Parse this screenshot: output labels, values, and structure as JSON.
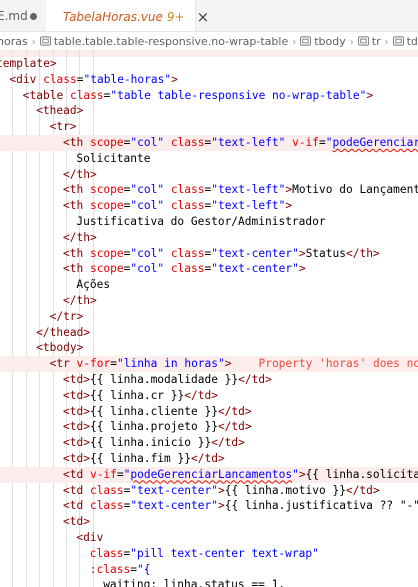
{
  "tabs": [
    {
      "label": "E.md",
      "modified": true
    },
    {
      "label": "TabelaHoras.vue",
      "badge": "9+",
      "close": "×",
      "active": true
    }
  ],
  "breadcrumb": [
    "horas",
    "table.table.table-responsive.no-wrap-table",
    "tbody",
    "tr",
    "td",
    "d"
  ],
  "code": {
    "lines": [
      {
        "indent": 0,
        "segs": [
          [
            "tag",
            "template>"
          ]
        ]
      },
      {
        "indent": 1,
        "segs": [
          [
            "tag",
            "<div "
          ],
          [
            "attr",
            "class"
          ],
          [
            "text",
            "="
          ],
          [
            "str",
            "\"table-horas\""
          ],
          [
            "tag",
            ">"
          ]
        ]
      },
      {
        "indent": 2,
        "segs": [
          [
            "tag",
            "<table "
          ],
          [
            "attr",
            "class"
          ],
          [
            "text",
            "="
          ],
          [
            "str",
            "\"table table-responsive no-wrap-table\""
          ],
          [
            "tag",
            ">"
          ]
        ]
      },
      {
        "indent": 3,
        "segs": [
          [
            "tag",
            "<thead>"
          ]
        ]
      },
      {
        "indent": 4,
        "segs": [
          [
            "tag",
            "<tr>"
          ]
        ]
      },
      {
        "indent": 5,
        "hl": true,
        "segs": [
          [
            "tag",
            "<th "
          ],
          [
            "attr",
            "scope"
          ],
          [
            "text",
            "="
          ],
          [
            "str",
            "\"col\" "
          ],
          [
            "attr",
            "class"
          ],
          [
            "text",
            "="
          ],
          [
            "str",
            "\"text-left\" "
          ],
          [
            "attr",
            "v-if"
          ],
          [
            "text",
            "="
          ],
          [
            "str",
            "\""
          ],
          [
            "sq",
            "podeGerenciarLanc"
          ]
        ]
      },
      {
        "indent": 6,
        "segs": [
          [
            "text",
            "Solicitante"
          ]
        ]
      },
      {
        "indent": 5,
        "segs": [
          [
            "tag",
            "</th>"
          ]
        ]
      },
      {
        "indent": 5,
        "segs": [
          [
            "tag",
            "<th "
          ],
          [
            "attr",
            "scope"
          ],
          [
            "text",
            "="
          ],
          [
            "str",
            "\"col\" "
          ],
          [
            "attr",
            "class"
          ],
          [
            "text",
            "="
          ],
          [
            "str",
            "\"text-left\""
          ],
          [
            "tag",
            ">"
          ],
          [
            "text",
            "Motivo do Lançamento"
          ],
          [
            "tag",
            "</t"
          ]
        ]
      },
      {
        "indent": 5,
        "segs": [
          [
            "tag",
            "<th "
          ],
          [
            "attr",
            "scope"
          ],
          [
            "text",
            "="
          ],
          [
            "str",
            "\"col\" "
          ],
          [
            "attr",
            "class"
          ],
          [
            "text",
            "="
          ],
          [
            "str",
            "\"text-left\""
          ],
          [
            "tag",
            ">"
          ]
        ]
      },
      {
        "indent": 6,
        "segs": [
          [
            "text",
            "Justificativa do Gestor/Administrador"
          ]
        ]
      },
      {
        "indent": 5,
        "segs": [
          [
            "tag",
            "</th>"
          ]
        ]
      },
      {
        "indent": 5,
        "segs": [
          [
            "tag",
            "<th "
          ],
          [
            "attr",
            "scope"
          ],
          [
            "text",
            "="
          ],
          [
            "str",
            "\"col\" "
          ],
          [
            "attr",
            "class"
          ],
          [
            "text",
            "="
          ],
          [
            "str",
            "\"text-center\""
          ],
          [
            "tag",
            ">"
          ],
          [
            "text",
            "Status"
          ],
          [
            "tag",
            "</th>"
          ]
        ]
      },
      {
        "indent": 5,
        "segs": [
          [
            "tag",
            "<th "
          ],
          [
            "attr",
            "scope"
          ],
          [
            "text",
            "="
          ],
          [
            "str",
            "\"col\" "
          ],
          [
            "attr",
            "class"
          ],
          [
            "text",
            "="
          ],
          [
            "str",
            "\"text-center\""
          ],
          [
            "tag",
            ">"
          ]
        ]
      },
      {
        "indent": 6,
        "segs": [
          [
            "text",
            "Ações"
          ]
        ]
      },
      {
        "indent": 5,
        "segs": [
          [
            "tag",
            "</th>"
          ]
        ]
      },
      {
        "indent": 4,
        "segs": [
          [
            "tag",
            "</tr>"
          ]
        ]
      },
      {
        "indent": 3,
        "segs": [
          [
            "tag",
            "</thead>"
          ]
        ]
      },
      {
        "indent": 3,
        "segs": [
          [
            "tag",
            "<tbody>"
          ]
        ]
      },
      {
        "indent": 4,
        "hl": true,
        "segs": [
          [
            "tag",
            "<tr "
          ],
          [
            "attr",
            "v-for"
          ],
          [
            "text",
            "="
          ],
          [
            "str",
            "\"linha in horas\""
          ],
          [
            "tag",
            ">"
          ],
          [
            "text",
            "    "
          ],
          [
            "ghost",
            "Property 'horas' does not ex"
          ]
        ]
      },
      {
        "indent": 5,
        "segs": [
          [
            "tag",
            "<td>"
          ],
          [
            "must",
            "{{ linha.modalidade }}"
          ],
          [
            "tag",
            "</td>"
          ]
        ]
      },
      {
        "indent": 5,
        "segs": [
          [
            "tag",
            "<td>"
          ],
          [
            "must",
            "{{ linha.cr }}"
          ],
          [
            "tag",
            "</td>"
          ]
        ]
      },
      {
        "indent": 5,
        "segs": [
          [
            "tag",
            "<td>"
          ],
          [
            "must",
            "{{ linha.cliente }}"
          ],
          [
            "tag",
            "</td>"
          ]
        ]
      },
      {
        "indent": 5,
        "segs": [
          [
            "tag",
            "<td>"
          ],
          [
            "must",
            "{{ linha.projeto }}"
          ],
          [
            "tag",
            "</td>"
          ]
        ]
      },
      {
        "indent": 5,
        "segs": [
          [
            "tag",
            "<td>"
          ],
          [
            "must",
            "{{ linha.inicio }}"
          ],
          [
            "tag",
            "</td>"
          ]
        ]
      },
      {
        "indent": 5,
        "segs": [
          [
            "tag",
            "<td>"
          ],
          [
            "must",
            "{{ linha.fim }}"
          ],
          [
            "tag",
            "</td>"
          ]
        ]
      },
      {
        "indent": 5,
        "hl": true,
        "segs": [
          [
            "tag",
            "<td "
          ],
          [
            "attr",
            "v-if"
          ],
          [
            "text",
            "="
          ],
          [
            "str",
            "\""
          ],
          [
            "sq",
            "podeGerenciarLancamentos"
          ],
          [
            "str",
            "\""
          ],
          [
            "tag",
            ">"
          ],
          [
            "must",
            "{{ linha.solicitante"
          ]
        ]
      },
      {
        "indent": 5,
        "segs": [
          [
            "tag",
            "<td "
          ],
          [
            "attr",
            "class"
          ],
          [
            "text",
            "="
          ],
          [
            "str",
            "\"text-center\""
          ],
          [
            "tag",
            ">"
          ],
          [
            "must",
            "{{ linha.motivo }}"
          ],
          [
            "tag",
            "</td>"
          ]
        ]
      },
      {
        "indent": 5,
        "segs": [
          [
            "tag",
            "<td "
          ],
          [
            "attr",
            "class"
          ],
          [
            "text",
            "="
          ],
          [
            "str",
            "\"text-center\""
          ],
          [
            "tag",
            ">"
          ],
          [
            "must",
            "{{ linha.justificativa ?? \"-\" }}"
          ],
          [
            "tag",
            "</"
          ]
        ]
      },
      {
        "indent": 5,
        "segs": [
          [
            "tag",
            "<td>"
          ]
        ]
      },
      {
        "indent": 6,
        "segs": [
          [
            "tag",
            "<div"
          ]
        ]
      },
      {
        "indent": 7,
        "segs": [
          [
            "attr",
            "class"
          ],
          [
            "text",
            "="
          ],
          [
            "str",
            "\"pill text-center text-wrap\""
          ]
        ]
      },
      {
        "indent": 7,
        "segs": [
          [
            "attr",
            ":class"
          ],
          [
            "text",
            "="
          ],
          [
            "str",
            "\"{"
          ]
        ]
      },
      {
        "indent": 8,
        "segs": [
          [
            "must",
            "waiting: linha.status == 1,"
          ]
        ]
      }
    ]
  },
  "colors": {
    "tag": "#800000",
    "attr": "#e50000",
    "str": "#0000ff",
    "text": "#000000",
    "error_line_bg": "#fcecec",
    "vue_green": "#41b883",
    "vue_dark": "#35495e"
  }
}
